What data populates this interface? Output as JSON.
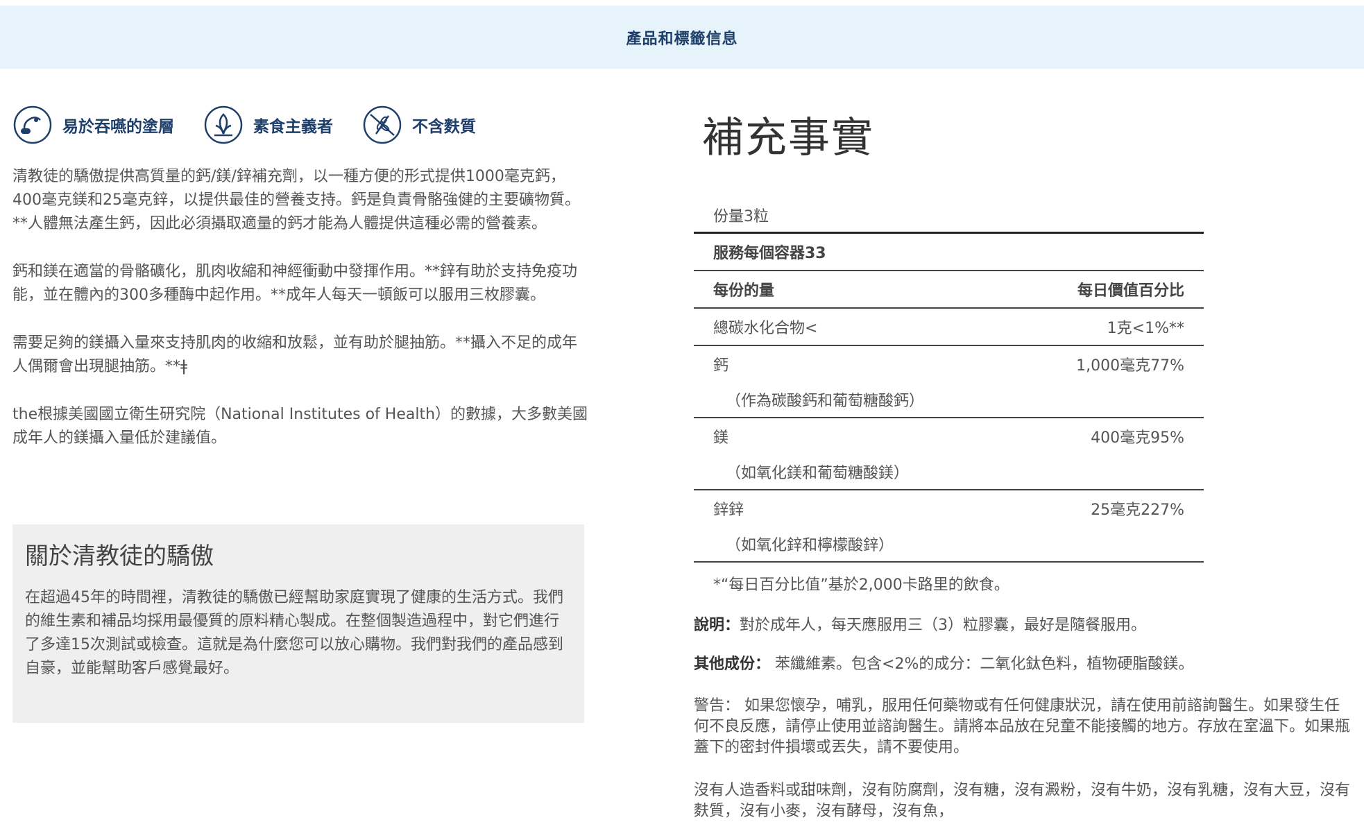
{
  "header": {
    "title": "產品和標籤信息"
  },
  "features": [
    {
      "icon": "capsule-swallow-icon",
      "label": "易於吞嚥的塗層"
    },
    {
      "icon": "vegan-leaf-icon",
      "label": "素食主義者"
    },
    {
      "icon": "gluten-free-icon",
      "label": "不含麩質"
    }
  ],
  "description": [
    "清教徒的驕傲提供高質量的鈣/鎂/鋅補充劑，以一種方便的形式提供1000毫克鈣，400毫克鎂和25毫克鋅，以提供最佳的營養支持。鈣是負責骨骼強健的主要礦物質。**人體無法產生鈣，因此必須攝取適量的鈣才能為人體提供這種必需的營養素。",
    "鈣和鎂在適當的骨骼礦化，肌肉收縮和神經衝動中發揮作用。**鋅有助於支持免疫功能，並在體內的300多種酶中起作用。**成年人每天一頓飯可以服用三枚膠囊。",
    "需要足夠的鎂攝入量來支持肌肉的收縮和放鬆，並有助於腿抽筋。**攝入不足的成年人偶爾會出現腿抽筋。**ǂ",
    "the根據美國國立衛生研究院（National Institutes of Health）的數據，大多數美國成年人的鎂攝入量低於建議值。"
  ],
  "about": {
    "title": "關於清教徒的驕傲",
    "text": "在超過45年的時間裡，清教徒的驕傲已經幫助家庭實現了健康的生活方式。我們的維生素和補品均採用最優質的原料精心製成。在整個製造過程中，對它們進行了多達15次測試或檢查。這就是為什麼您可以放心購物。我們對我們的產品感到自豪，並能幫助客戶感覺最好。"
  },
  "supplement_facts": {
    "title": "補充事實",
    "serving_size": "份量3粒",
    "servings_per_container": "服務每個容器33",
    "col_amount": "每份的量",
    "col_dv": "每日價值百分比",
    "rows": [
      {
        "name": "總碳水化合物<",
        "value": "1克<1%**",
        "sub": ""
      },
      {
        "name": "鈣",
        "value": "1,000毫克77%",
        "sub": "（作為碳酸鈣和葡萄糖酸鈣）"
      },
      {
        "name": "鎂",
        "value": "400毫克95%",
        "sub": "（如氧化鎂和葡萄糖酸鎂）"
      },
      {
        "name": "鋅鋅",
        "value": "25毫克227%",
        "sub": "（如氧化鋅和檸檬酸鋅）"
      }
    ],
    "footnote": "*“每日百分比值”基於2,000卡路里的飲食。"
  },
  "directions": {
    "label": "說明：",
    "text": "對於成年人，每天應服用三（3）粒膠囊，最好是隨餐服用。"
  },
  "other_ingredients": {
    "label": "其他成份：",
    "text": " 苯纖維素。包含<2%的成分：二氧化鈦色料，植物硬脂酸鎂。"
  },
  "warning": "警告： 如果您懷孕，哺乳，服用任何藥物或有任何健康狀況，請在使用前諮詢醫生。如果發生任何不良反應，請停止使用並諮詢醫生。請將本品放在兒童不能接觸的地方。存放在室溫下。如果瓶蓋下的密封件損壞或丟失，請不要使用。",
  "free_from": "沒有人造香料或甜味劑，沒有防腐劑，沒有糖，沒有澱粉，沒有牛奶，沒有乳糖，沒有大豆，沒有麩質，沒有小麥，沒有酵母，沒有魚，",
  "colors": {
    "navy": "#1f3f6b",
    "header_bg": "#e6f3fb",
    "about_bg": "#efefef"
  }
}
